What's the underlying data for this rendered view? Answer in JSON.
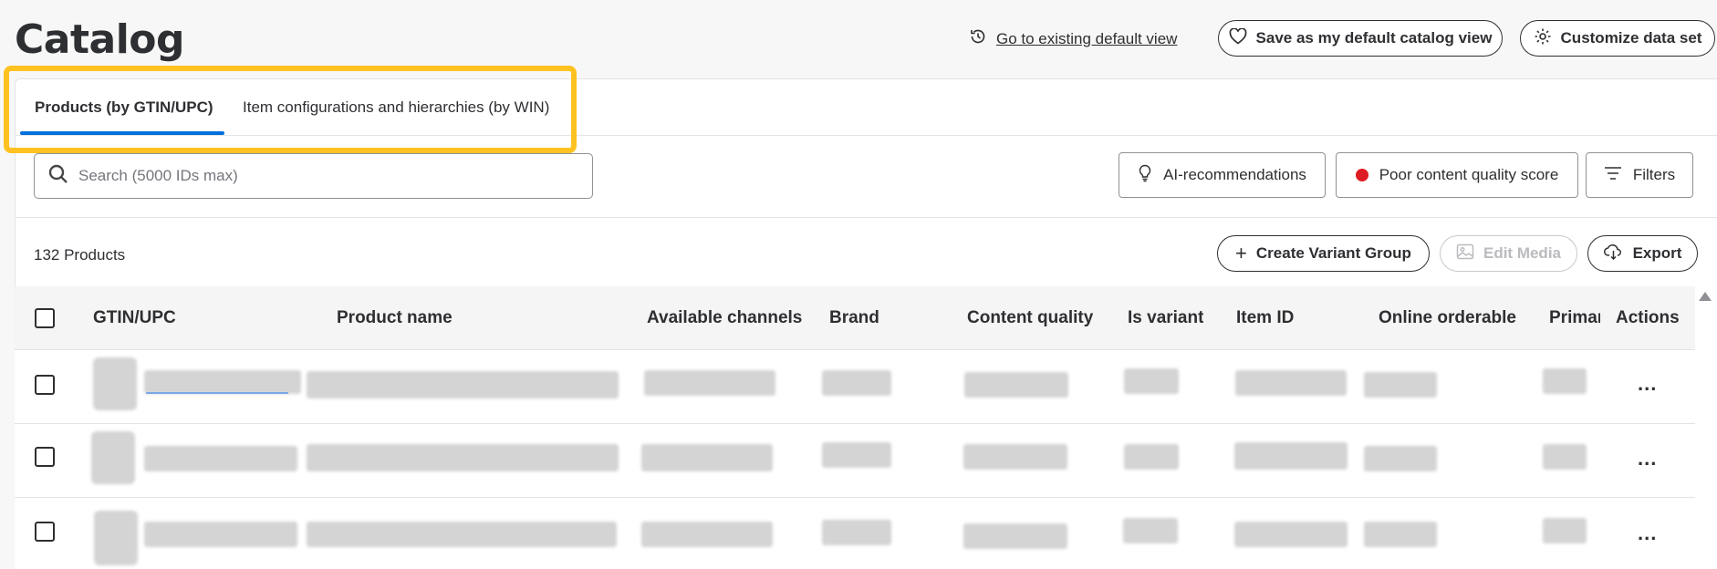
{
  "header": {
    "title": "Catalog",
    "go_default_link": "Go to existing default view",
    "save_default_label": "Save as my default catalog view",
    "customize_label": "Customize data set"
  },
  "tabs": [
    {
      "label": "Products (by GTIN/UPC)",
      "active": true
    },
    {
      "label": "Item configurations and hierarchies (by WIN)",
      "active": false
    }
  ],
  "search": {
    "placeholder": "Search (5000 IDs max)",
    "value": ""
  },
  "filters": {
    "ai_label": "AI-recommendations",
    "poor_quality_label": "Poor content quality score",
    "filters_label": "Filters"
  },
  "toolbar": {
    "count": "132 Products",
    "create_variant_label": "Create Variant Group",
    "edit_media_label": "Edit Media",
    "export_label": "Export"
  },
  "table": {
    "columns": [
      "GTIN/UPC",
      "Product name",
      "Available channels",
      "Brand",
      "Content quality",
      "Is variant",
      "Item ID",
      "Online orderable",
      "Primar",
      "Actions"
    ],
    "rows": [
      {
        "actions": "..."
      },
      {
        "actions": "..."
      },
      {
        "actions": "..."
      }
    ]
  },
  "colors": {
    "accent_blue": "#0071dc",
    "highlight_yellow": "#ffc220",
    "status_red": "#de1c24",
    "text": "#2e2f32"
  }
}
